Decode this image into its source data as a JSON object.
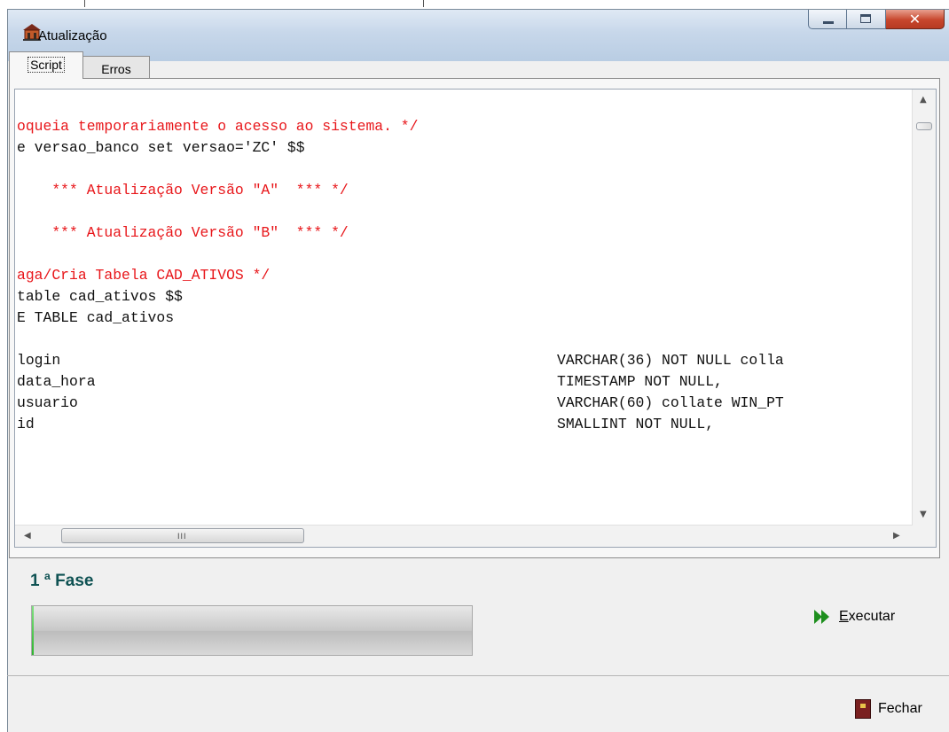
{
  "window": {
    "title": "Atualização"
  },
  "tabs": [
    {
      "label": "Script",
      "active": true
    },
    {
      "label": "Erros",
      "active": false
    }
  ],
  "script": {
    "lines": [
      {
        "text": "oqueia temporariamente o acesso ao sistema. */",
        "color": "red"
      },
      {
        "text": "e versao_banco set versao='ZC' $$",
        "color": "black"
      },
      {
        "text": "",
        "color": "black"
      },
      {
        "text": "    *** Atualização Versão \"A\"  *** */",
        "color": "red"
      },
      {
        "text": "",
        "color": "black"
      },
      {
        "text": "    *** Atualização Versão \"B\"  *** */",
        "color": "red"
      },
      {
        "text": "",
        "color": "black"
      },
      {
        "text": "aga/Cria Tabela CAD_ATIVOS */",
        "color": "red"
      },
      {
        "text": "table cad_ativos $$",
        "color": "black"
      },
      {
        "text": "E TABLE cad_ativos",
        "color": "black"
      },
      {
        "text": "",
        "color": "black"
      },
      {
        "text": "login",
        "col2": "VARCHAR(36) NOT NULL colla",
        "color": "black"
      },
      {
        "text": "data_hora",
        "col2": "TIMESTAMP NOT NULL,",
        "color": "black"
      },
      {
        "text": "usuario",
        "col2": "VARCHAR(60) collate WIN_PT",
        "color": "black"
      },
      {
        "text": "id",
        "col2": "SMALLINT NOT NULL,",
        "color": "black"
      }
    ]
  },
  "phase": {
    "label": "1 ª Fase"
  },
  "progress": {
    "fraction": 0.004
  },
  "buttons": {
    "execute_prefix": "E",
    "execute_rest": "xecutar",
    "close": "Fechar"
  },
  "colors": {
    "red": "#e8161a",
    "teal": "#0f5253",
    "progress_green": "#2fb52f"
  }
}
